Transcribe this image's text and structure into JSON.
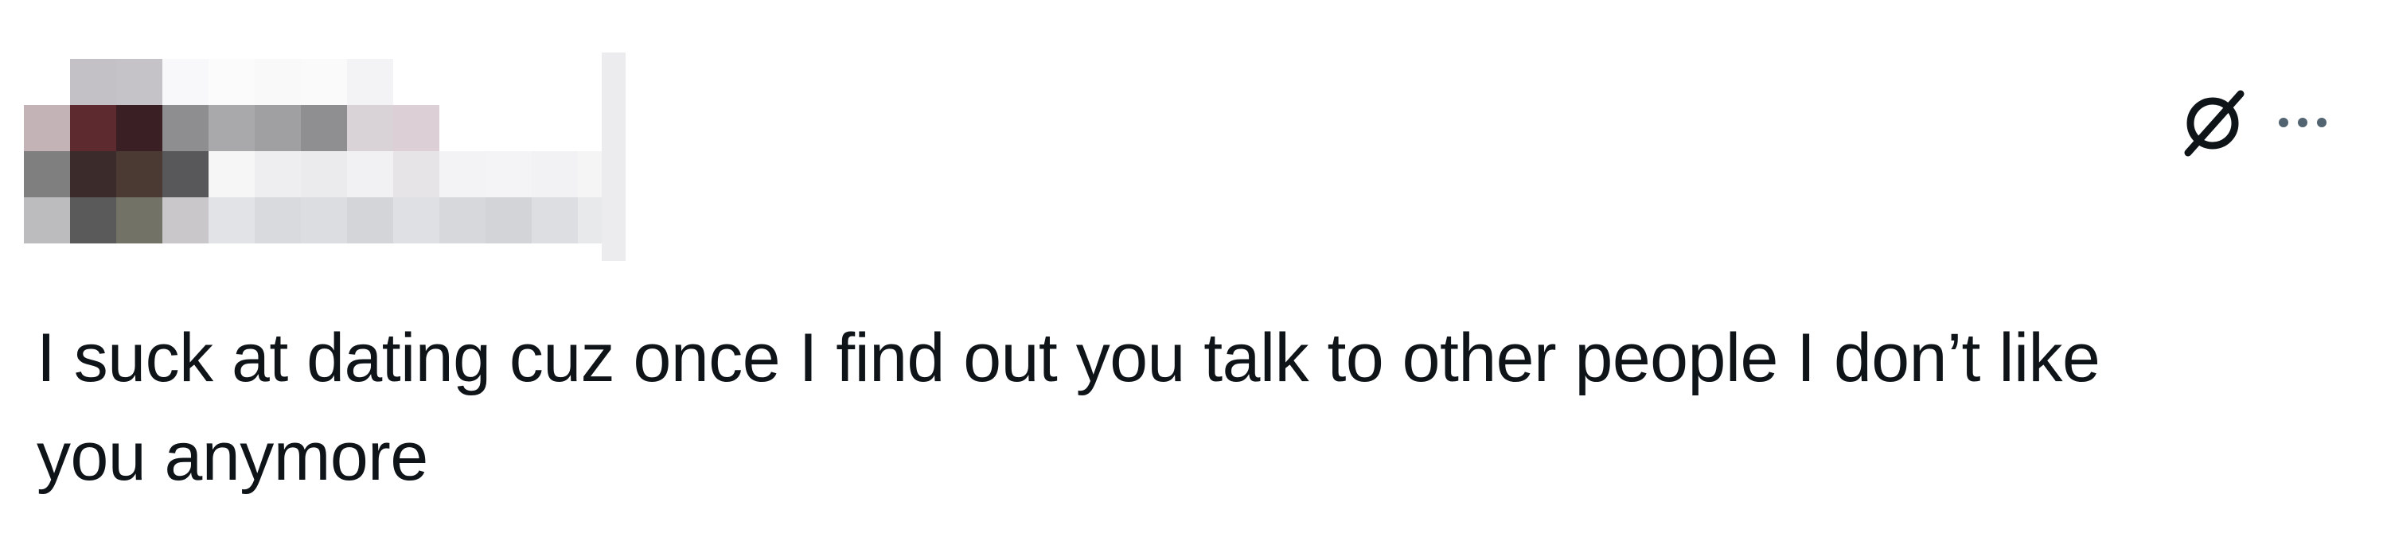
{
  "post": {
    "author": {
      "redacted": true,
      "pixel_colors": [
        [
          "#ffffff",
          "#c3c1c6",
          "#c6c3c8",
          "#f8f8fa",
          "#fbfbfb",
          "#f9f9fa",
          "#fafafa",
          "#f3f3f5",
          "#ffffff",
          "#ffffff",
          "#ffffff",
          "#ffffff",
          "#ffffff"
        ],
        [
          "#c4b3b6",
          "#5d2a30",
          "#3a1f24",
          "#8e8e90",
          "#a9a9ac",
          "#a0a0a3",
          "#8f8f92",
          "#d9d2d7",
          "#dccfd6",
          "#ffffff",
          "#ffffff",
          "#ffffff",
          "#ffffff"
        ],
        [
          "#7f7f80",
          "#3b2b2a",
          "#4a3a33",
          "#58585b",
          "#f6f6f7",
          "#eeeef0",
          "#ebebed",
          "#f1f1f3",
          "#e7e4e8",
          "#f3f3f5",
          "#f4f4f6",
          "#f2f2f4",
          "#f5f5f6"
        ],
        [
          "#bcbcbf",
          "#5a5a5a",
          "#727266",
          "#c9c7c9",
          "#e2e3e6",
          "#d8dadd",
          "#dbdde0",
          "#d3d5d9",
          "#dee0e3",
          "#d6d8db",
          "#d2d4d8",
          "#dcdee1",
          "#e8e9eb"
        ]
      ]
    },
    "actions": {
      "grok_icon": "grok-icon",
      "more_icon": "more-options-icon",
      "icon_color": "#0f1419",
      "more_color": "#536471"
    },
    "text": "I suck at dating cuz once I find out you talk to other people I don’t like\nyou anymore"
  }
}
